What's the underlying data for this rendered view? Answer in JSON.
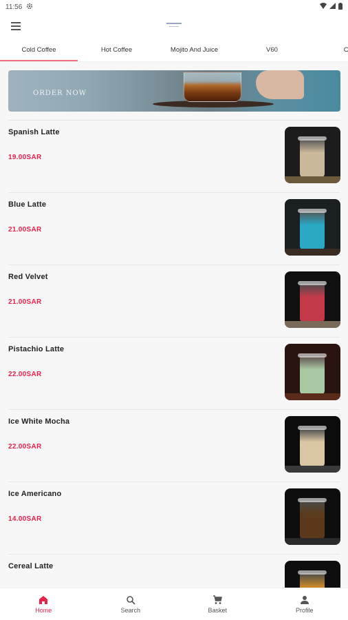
{
  "status": {
    "time": "11:56"
  },
  "tabs": [
    {
      "label": "Cold Coffee",
      "active": true
    },
    {
      "label": "Hot Coffee",
      "active": false
    },
    {
      "label": "Mojito And Juice",
      "active": false
    },
    {
      "label": "V60",
      "active": false
    },
    {
      "label": "Che",
      "active": false
    }
  ],
  "banner": {
    "text": "ORDER NOW"
  },
  "items": [
    {
      "name": "Spanish Latte",
      "price": "19.00SAR",
      "img": {
        "bg": "#1c1c1c",
        "drink": "#c9b89a",
        "base": "#6b5a3c"
      }
    },
    {
      "name": "Blue Latte",
      "price": "21.00SAR",
      "img": {
        "bg": "#1a1f22",
        "drink": "#2aa8c4",
        "base": "#3a2c22"
      }
    },
    {
      "name": "Red Velvet",
      "price": "21.00SAR",
      "img": {
        "bg": "#101010",
        "drink": "#c4394a",
        "base": "#7a6a5a"
      }
    },
    {
      "name": "Pistachio Latte",
      "price": "22.00SAR",
      "img": {
        "bg": "#2a1410",
        "drink": "#a9c9a4",
        "base": "#5a2a1a"
      }
    },
    {
      "name": "Ice White Mocha",
      "price": "22.00SAR",
      "img": {
        "bg": "#0c0c0c",
        "drink": "#d9c7a4",
        "base": "#3a3a3a"
      }
    },
    {
      "name": "Ice Americano",
      "price": "14.00SAR",
      "img": {
        "bg": "#0e0e0e",
        "drink": "#5a3a1a",
        "base": "#2a2a2a"
      }
    },
    {
      "name": "Cereal Latte",
      "price": "",
      "img": {
        "bg": "#0e0e0e",
        "drink": "#c9882a",
        "base": "#2a1a0a"
      }
    }
  ],
  "nav": [
    {
      "label": "Home",
      "icon": "home-icon",
      "active": true
    },
    {
      "label": "Search",
      "icon": "search-icon",
      "active": false
    },
    {
      "label": "Basket",
      "icon": "cart-icon",
      "active": false
    },
    {
      "label": "Profile",
      "icon": "person-icon",
      "active": false
    }
  ],
  "colors": {
    "accent": "#e8204a",
    "tab_indicator": "#f06b7d"
  }
}
